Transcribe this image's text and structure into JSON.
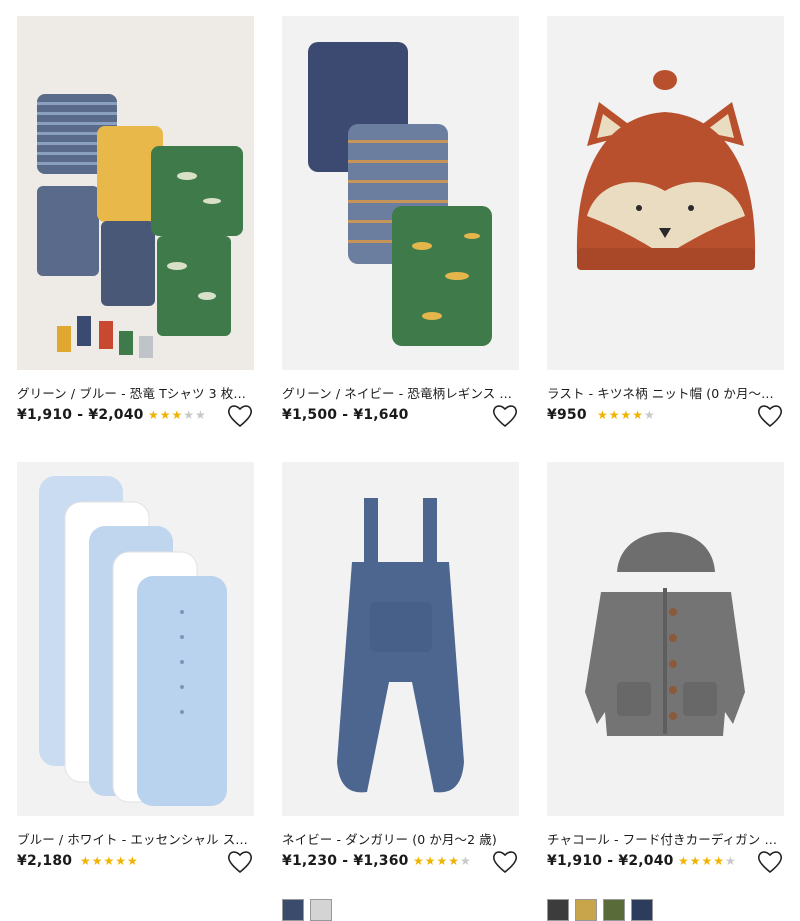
{
  "products": [
    {
      "title": "グリーン / ブルー - 恐竜 Tシャツ 3 枚…",
      "price": "¥1,910 - ¥2,040",
      "rating_stars": 3,
      "swatches": []
    },
    {
      "title": "グリーン / ネイビー - 恐竜柄レギンス …",
      "price": "¥1,500 - ¥1,640",
      "rating_stars": 0,
      "swatches": []
    },
    {
      "title": "ラスト - キツネ柄 ニット帽 (0 か月〜2…",
      "price": "¥950",
      "rating_stars": 4,
      "swatches": []
    },
    {
      "title": "ブルー / ホワイト - エッセンシャル ス…",
      "price": "¥2,180",
      "rating_stars": 5,
      "swatches": []
    },
    {
      "title": "ネイビー - ダンガリー (0 か月〜2 歳)",
      "price": "¥1,230 - ¥1,360",
      "rating_stars": 4.5,
      "swatches": [
        "#3b4b6b",
        "#d4d4d4"
      ]
    },
    {
      "title": "チャコール - フード付きカーディガン (…",
      "price": "¥1,910 - ¥2,040",
      "rating_stars": 4.5,
      "swatches": [
        "#3c3c3c",
        "#c8a54a",
        "#5a6b3a",
        "#2c3c5c"
      ]
    }
  ],
  "icons": {
    "wishlist": "heart-outline-icon",
    "star": "★"
  }
}
